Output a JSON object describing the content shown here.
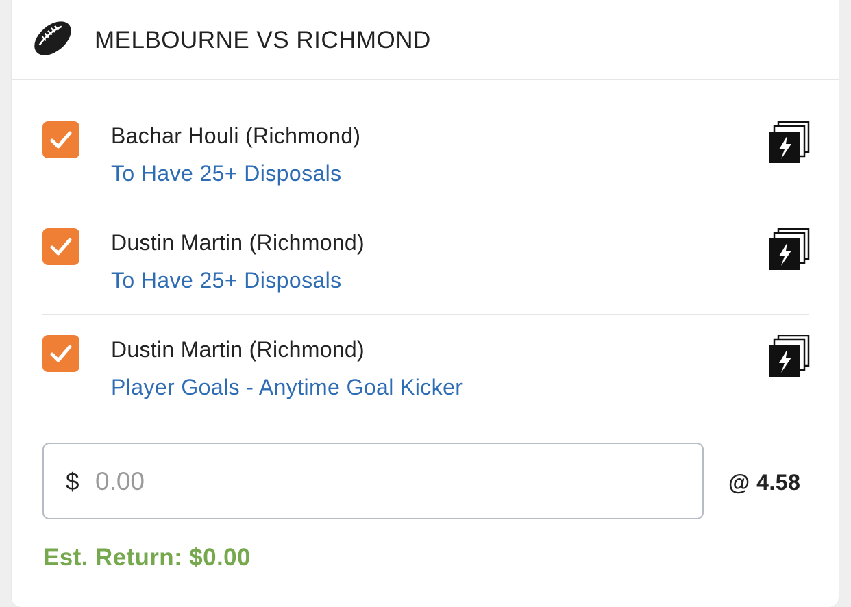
{
  "event": {
    "title": "MELBOURNE VS RICHMOND",
    "sport_icon": "football-icon"
  },
  "legs": [
    {
      "player": "Bachar Houli (Richmond)",
      "market": "To Have 25+ Disposals",
      "checked": true,
      "action_icon": "same-game-multi-icon"
    },
    {
      "player": "Dustin Martin (Richmond)",
      "market": "To Have 25+ Disposals",
      "checked": true,
      "action_icon": "same-game-multi-icon"
    },
    {
      "player": "Dustin Martin (Richmond)",
      "market": "Player Goals - Anytime Goal Kicker",
      "checked": true,
      "action_icon": "same-game-multi-icon"
    }
  ],
  "stake": {
    "currency": "$",
    "value": "",
    "placeholder": "0.00"
  },
  "odds": "@ 4.58",
  "est_return": "Est. Return: $0.00",
  "colors": {
    "checkbox": "#ef7f35",
    "market_link": "#2e6db4",
    "est_return": "#76a84e"
  }
}
